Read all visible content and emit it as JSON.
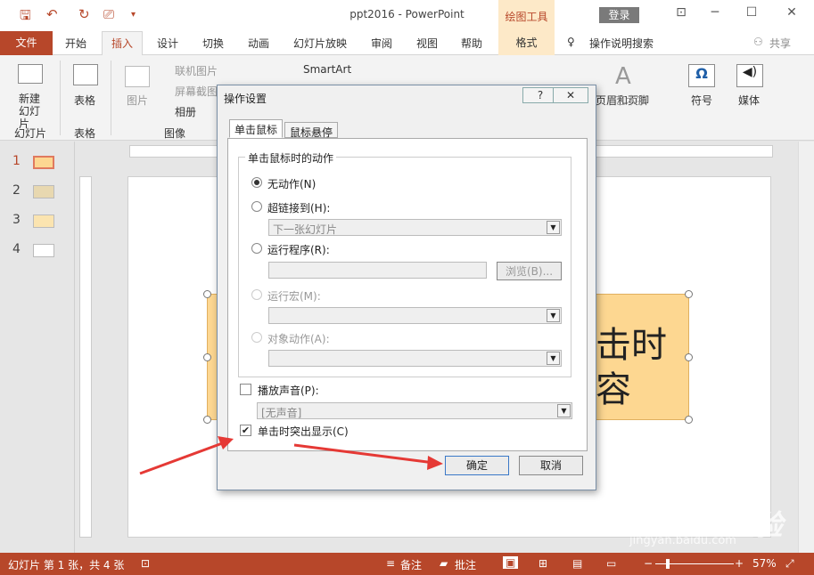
{
  "title": "ppt2016 - PowerPoint",
  "context_tab": "绘图工具",
  "login": "登录",
  "tabs": [
    "开始",
    "插入",
    "设计",
    "切换",
    "动画",
    "幻灯片放映",
    "审阅",
    "视图",
    "帮助",
    "格式"
  ],
  "file_tab": "文件",
  "active_tab": "插入",
  "tell_me": "操作说明搜索",
  "share": "共享",
  "ribbon": {
    "new_slide": "新建\n幻灯片",
    "slides_group": "幻灯片",
    "table": "表格",
    "tables_group": "表格",
    "picture": "图片",
    "online_pictures": "联机图片",
    "screenshot": "屏幕截图",
    "album": "相册",
    "images_group": "图像",
    "smartart": "SmartArt",
    "header_footer": "页眉和页脚",
    "wordart": "艺术字",
    "symbols": "符号",
    "media": "媒体"
  },
  "thumbs": [
    "1",
    "2",
    "3",
    "4"
  ],
  "shape_text": [
    "击时",
    "容"
  ],
  "dialog": {
    "title": "操作设置",
    "help": "?",
    "close": "✕",
    "tab1": "单击鼠标",
    "tab2": "鼠标悬停",
    "legend": "单击鼠标时的动作",
    "options": [
      "无动作(N)",
      "超链接到(H):",
      "运行程序(R):",
      "运行宏(M):",
      "对象动作(A):"
    ],
    "hyperlink_value": "下一张幻灯片",
    "browse": "浏览(B)...",
    "play_sound": "播放声音(P):",
    "sound_value": "[无声音]",
    "highlight": "单击时突出显示(C)",
    "ok": "确定",
    "cancel": "取消"
  },
  "status": {
    "slide_info": "幻灯片 第 1 张，共 4 张",
    "notes": "备注",
    "comments": "批注",
    "zoom": "57%"
  },
  "watermark": "Baidu 经验",
  "watermark_url": "jingyan.baidu.com"
}
